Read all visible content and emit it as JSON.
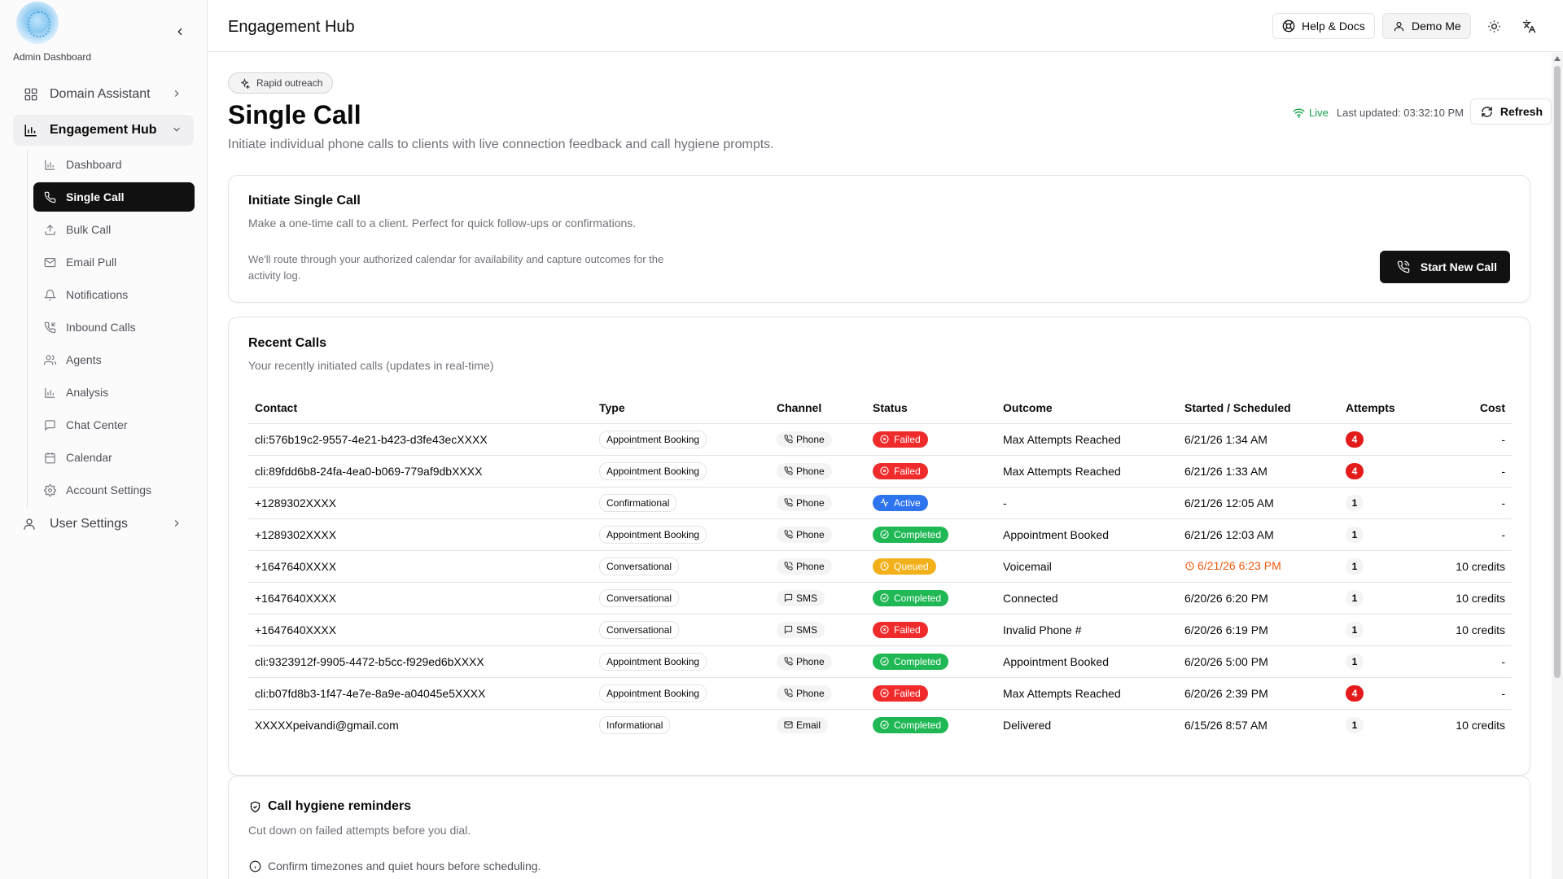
{
  "brand": {
    "label": "Admin Dashboard"
  },
  "sidebar": {
    "top_items": [
      {
        "label": "Domain Assistant",
        "icon": "grid-icon"
      },
      {
        "label": "Engagement Hub",
        "icon": "bar-chart-icon"
      },
      {
        "label": "User Settings",
        "icon": "user-icon"
      }
    ],
    "sub_items": [
      {
        "label": "Dashboard",
        "icon": "bar-chart-icon"
      },
      {
        "label": "Single Call",
        "icon": "phone-icon"
      },
      {
        "label": "Bulk Call",
        "icon": "upload-icon"
      },
      {
        "label": "Email Pull",
        "icon": "mail-icon"
      },
      {
        "label": "Notifications",
        "icon": "bell-icon"
      },
      {
        "label": "Inbound Calls",
        "icon": "phone-incoming-icon"
      },
      {
        "label": "Agents",
        "icon": "users-icon"
      },
      {
        "label": "Analysis",
        "icon": "bar-chart-icon"
      },
      {
        "label": "Chat Center",
        "icon": "message-icon"
      },
      {
        "label": "Calendar",
        "icon": "calendar-icon"
      },
      {
        "label": "Account Settings",
        "icon": "gear-icon"
      }
    ]
  },
  "header": {
    "title": "Engagement Hub",
    "help_label": "Help & Docs",
    "user_label": "Demo Me"
  },
  "page": {
    "badge": "Rapid outreach",
    "title": "Single Call",
    "subtitle": "Initiate individual phone calls to clients with live connection feedback and call hygiene prompts.",
    "live_label": "Live",
    "last_updated": "Last updated: 03:32:10 PM",
    "refresh_label": "Refresh"
  },
  "initiate": {
    "title": "Initiate Single Call",
    "description": "Make a one-time call to a client. Perfect for quick follow-ups or confirmations.",
    "note_line1": "We'll route through your authorized calendar for availability and capture outcomes for the",
    "note_line2": "activity log.",
    "button_label": "Start New Call"
  },
  "recent": {
    "title": "Recent Calls",
    "description": "Your recently initiated calls (updates in real-time)",
    "columns": [
      "Contact",
      "Type",
      "Channel",
      "Status",
      "Outcome",
      "Started / Scheduled",
      "Attempts",
      "Cost"
    ],
    "rows": [
      {
        "contact": "cli:576b19c2-9557-4e21-b423-d3fe43ecXXXX",
        "type": "Appointment Booking",
        "channel": "Phone",
        "status": "Failed",
        "outcome": "Max Attempts Reached",
        "started": "6/21/26 1:34 AM",
        "attempts": "4",
        "cost": "-"
      },
      {
        "contact": "cli:89fdd6b8-24fa-4ea0-b069-779af9dbXXXX",
        "type": "Appointment Booking",
        "channel": "Phone",
        "status": "Failed",
        "outcome": "Max Attempts Reached",
        "started": "6/21/26 1:33 AM",
        "attempts": "4",
        "cost": "-"
      },
      {
        "contact": "+1289302XXXX",
        "type": "Confirmational",
        "channel": "Phone",
        "status": "Active",
        "outcome": "-",
        "started": "6/21/26 12:05 AM",
        "attempts": "1",
        "cost": "-"
      },
      {
        "contact": "+1289302XXXX",
        "type": "Appointment Booking",
        "channel": "Phone",
        "status": "Completed",
        "outcome": "Appointment Booked",
        "started": "6/21/26 12:03 AM",
        "attempts": "1",
        "cost": "-"
      },
      {
        "contact": "+1647640XXXX",
        "type": "Conversational",
        "channel": "Phone",
        "status": "Queued",
        "outcome": "Voicemail",
        "started": "6/21/26 6:23 PM",
        "attempts": "1",
        "cost": "10 credits"
      },
      {
        "contact": "+1647640XXXX",
        "type": "Conversational",
        "channel": "SMS",
        "status": "Completed",
        "outcome": "Connected",
        "started": "6/20/26 6:20 PM",
        "attempts": "1",
        "cost": "10 credits"
      },
      {
        "contact": "+1647640XXXX",
        "type": "Conversational",
        "channel": "SMS",
        "status": "Failed",
        "outcome": "Invalid Phone #",
        "started": "6/20/26 6:19 PM",
        "attempts": "1",
        "cost": "10 credits"
      },
      {
        "contact": "cli:9323912f-9905-4472-b5cc-f929ed6bXXXX",
        "type": "Appointment Booking",
        "channel": "Phone",
        "status": "Completed",
        "outcome": "Appointment Booked",
        "started": "6/20/26 5:00 PM",
        "attempts": "1",
        "cost": "-"
      },
      {
        "contact": "cli:b07fd8b3-1f47-4e7e-8a9e-a04045e5XXXX",
        "type": "Appointment Booking",
        "channel": "Phone",
        "status": "Failed",
        "outcome": "Max Attempts Reached",
        "started": "6/20/26 2:39 PM",
        "attempts": "4",
        "cost": "-"
      },
      {
        "contact": "XXXXXpeivandi@gmail.com",
        "type": "Informational",
        "channel": "Email",
        "status": "Completed",
        "outcome": "Delivered",
        "started": "6/15/26 8:57 AM",
        "attempts": "1",
        "cost": "10 credits"
      }
    ]
  },
  "hygiene": {
    "title": "Call hygiene reminders",
    "description": "Cut down on failed attempts before you dial.",
    "item1": "Confirm timezones and quiet hours before scheduling."
  },
  "colors": {
    "failed": "#ef2b2b",
    "active": "#2f74ef",
    "completed": "#1fb854",
    "queued": "#f2b01b",
    "live": "#16a34a",
    "warn": "#ea580c"
  }
}
